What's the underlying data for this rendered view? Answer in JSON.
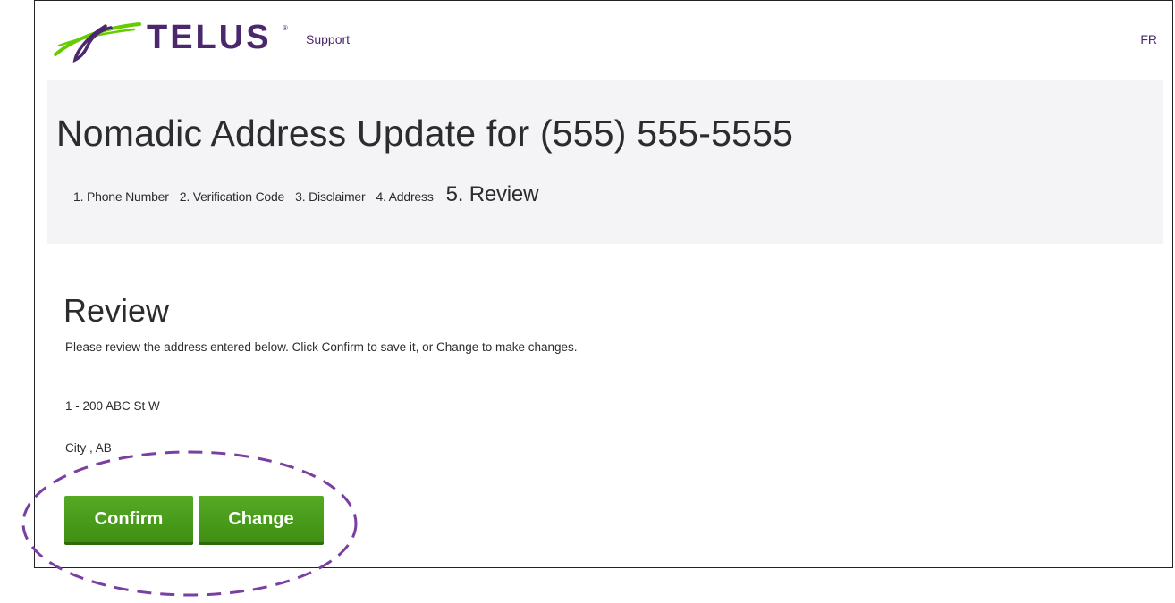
{
  "header": {
    "logo_text": "TELUS",
    "logo_reg_mark": "®",
    "support_link": "Support",
    "language_link": "FR"
  },
  "banner": {
    "title": "Nomadic Address Update for (555) 555-5555",
    "steps": [
      {
        "label": "1. Phone Number",
        "current": false
      },
      {
        "label": "2. Verification Code",
        "current": false
      },
      {
        "label": "3. Disclaimer",
        "current": false
      },
      {
        "label": "4. Address",
        "current": false
      },
      {
        "label": "5. Review",
        "current": true
      }
    ]
  },
  "review": {
    "title": "Review",
    "instructions": "Please review the address entered below. Click Confirm to save it, or Change to make changes.",
    "address_line1": "1 - 200 ABC St W",
    "address_line2": "City , AB"
  },
  "actions": {
    "confirm_label": "Confirm",
    "change_label": "Change"
  },
  "colors": {
    "brand_purple": "#4b286d",
    "brand_green": "#66cc00",
    "button_green": "#48a01a",
    "banner_bg": "#f4f4f7",
    "annotation_purple": "#7a3fa0"
  },
  "icons": {
    "logo_mark": "telus-leaf-logo-icon"
  }
}
